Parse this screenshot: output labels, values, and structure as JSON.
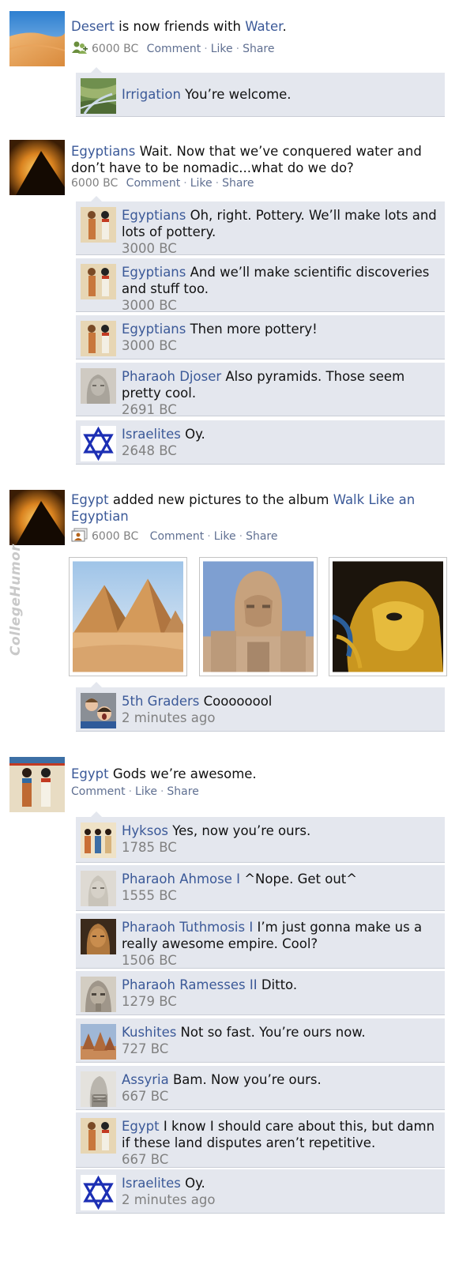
{
  "post1": {
    "actor": "Desert",
    "action_mid": " is now friends with ",
    "target": "Water",
    "end": ".",
    "time": "6000 BC",
    "actions": {
      "comment": "Comment",
      "like": "Like",
      "share": "Share"
    },
    "comments": [
      {
        "name": "Irrigation",
        "text": " You’re welcome.",
        "time": ""
      }
    ]
  },
  "post2": {
    "actor": "Egyptians",
    "text": " Wait. Now that we’ve conquered water and don’t have to be nomadic...what do we do?",
    "time": "6000 BC",
    "actions": {
      "comment": "Comment",
      "like": "Like",
      "share": "Share"
    },
    "comments": [
      {
        "name": "Egyptians",
        "text": " Oh, right. Pottery. We’ll make lots and lots of pottery.",
        "time": "3000 BC"
      },
      {
        "name": "Egyptians",
        "text": " And we’ll make scientific discoveries and stuff too.",
        "time": "3000 BC"
      },
      {
        "name": "Egyptians",
        "text": " Then more pottery!",
        "time": "3000 BC"
      },
      {
        "name": "Pharaoh Djoser",
        "text": " Also pyramids. Those seem pretty cool.",
        "time": "2691 BC"
      },
      {
        "name": "Israelites",
        "text": " Oy.",
        "time": "2648 BC"
      }
    ]
  },
  "post3": {
    "actor": "Egypt",
    "action_mid": " added new pictures to the album ",
    "album": "Walk Like an Egyptian",
    "time": "6000 BC",
    "actions": {
      "comment": "Comment",
      "like": "Like",
      "share": "Share"
    },
    "photos": [
      "pyramids-photo",
      "sphinx-photo",
      "golden-mask-photo"
    ],
    "comments": [
      {
        "name": "5th Graders",
        "text": " Coooooool",
        "time": "2 minutes ago"
      }
    ]
  },
  "post4": {
    "actor": "Egypt",
    "text": " Gods we’re awesome.",
    "actions": {
      "comment": "Comment",
      "like": "Like",
      "share": "Share"
    },
    "comments": [
      {
        "name": "Hyksos",
        "text": " Yes, now you’re ours.",
        "time": "1785 BC"
      },
      {
        "name": "Pharaoh Ahmose I",
        "text": " ^Nope. Get out^",
        "time": "1555 BC"
      },
      {
        "name": "Pharaoh Tuthmosis I",
        "text": " I’m just gonna make us a really awesome empire. Cool?",
        "time": "1506 BC"
      },
      {
        "name": "Pharaoh Ramesses II",
        "text": " Ditto.",
        "time": "1279 BC"
      },
      {
        "name": "Kushites",
        "text": " Not so fast. You’re ours now.",
        "time": "727 BC"
      },
      {
        "name": "Assyria",
        "text": " Bam. Now you’re ours.",
        "time": "667 BC"
      },
      {
        "name": "Egypt",
        "text": " I know I should care about this, but damn if these land disputes aren’t repetitive.",
        "time": "667 BC"
      },
      {
        "name": "Israelites",
        "text": " Oy.",
        "time": "2 minutes ago"
      }
    ]
  },
  "watermark": "CollegeHumor",
  "colors": {
    "link": "#3b5998",
    "comment_bg": "#e4e7ee",
    "timestamp": "#808080"
  }
}
